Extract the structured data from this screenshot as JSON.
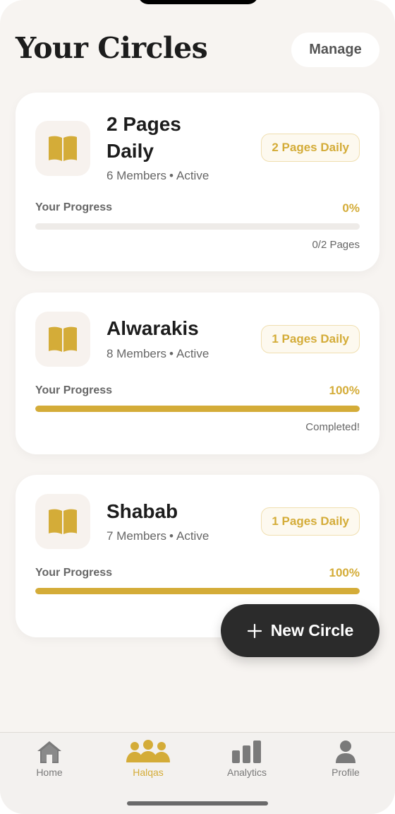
{
  "header": {
    "title": "Your Circles",
    "manage_label": "Manage"
  },
  "circles": [
    {
      "name_line1": "2 Pages",
      "name_line2": "Daily",
      "members": "6 Members",
      "separator": "•",
      "status": "Active",
      "badge": "2 Pages Daily",
      "progress_label": "Your Progress",
      "progress_pct": "0%",
      "progress_value": 0,
      "progress_note": "0/2 Pages"
    },
    {
      "name": "Alwarakis",
      "members": "8 Members",
      "separator": "•",
      "status": "Active",
      "badge": "1 Pages Daily",
      "progress_label": "Your Progress",
      "progress_pct": "100%",
      "progress_value": 1,
      "progress_note": "Completed!"
    },
    {
      "name": "Shabab",
      "members": "7 Members",
      "separator": "•",
      "status": "Active",
      "badge": "1 Pages Daily",
      "progress_label": "Your Progress",
      "progress_pct": "100%",
      "progress_value": 1
    }
  ],
  "fab": {
    "icon": "plus-icon",
    "label": "New Circle"
  },
  "tabbar": {
    "tabs": [
      {
        "icon": "home-icon",
        "label": "Home",
        "active": false
      },
      {
        "icon": "group-icon",
        "label": "Halqas",
        "active": true
      },
      {
        "icon": "bar-chart-icon",
        "label": "Analytics",
        "active": false
      },
      {
        "icon": "person-icon",
        "label": "Profile",
        "active": false
      }
    ]
  },
  "colors": {
    "accent": "#d4ac38",
    "background": "#f7f4f1",
    "dark": "#2b2b2b"
  }
}
